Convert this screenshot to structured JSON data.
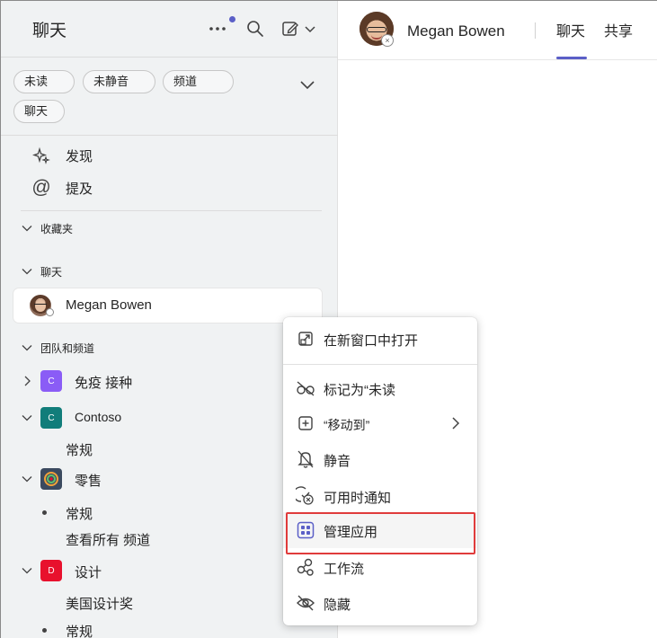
{
  "left_header": {
    "title": "聊天",
    "more_icon": "more-icon",
    "search_icon": "search-icon",
    "compose_icon": "compose-icon"
  },
  "filters": {
    "unread": "未读",
    "unmuted": "未静音",
    "channels": "频道",
    "chats": "聊天"
  },
  "nav": {
    "discover": "发现",
    "mentions": "提及"
  },
  "sections": {
    "favorites": "收藏夹",
    "chats": "聊天",
    "teams_and_channels": "团队和频道"
  },
  "chat_item": {
    "name": "Megan Bowen"
  },
  "teams": [
    {
      "tile_text": "C",
      "tile_color": "#8a5cf6",
      "name": "免疫 接种"
    },
    {
      "tile_text": "C",
      "tile_color": "#117d7a",
      "name": "Contoso"
    },
    {
      "tile_text": "",
      "tile_color": "#3b4a5f",
      "name": "零售"
    },
    {
      "tile_text": "D",
      "tile_color": "#e8112d",
      "name": "设计"
    }
  ],
  "channels": {
    "contoso_general": "常规",
    "retail_general": "常规",
    "retail_all": "查看所有 频道",
    "design_award": "美国设计奖",
    "design_general": "常规"
  },
  "right_header": {
    "name": "Megan Bowen",
    "tab_chat": "聊天",
    "tab_shared": "共享"
  },
  "context_menu": {
    "open_new_window": "在新窗口中打开",
    "mark_unread": "标记为“未读",
    "move_to": "“移动到”",
    "mute": "静音",
    "notify_available": "可用时通知",
    "manage_apps": "管理应用",
    "workflows": "工作流",
    "hide": "隐藏"
  },
  "colors": {
    "accent": "#5b5fc7",
    "highlight": "#e03b3b"
  }
}
